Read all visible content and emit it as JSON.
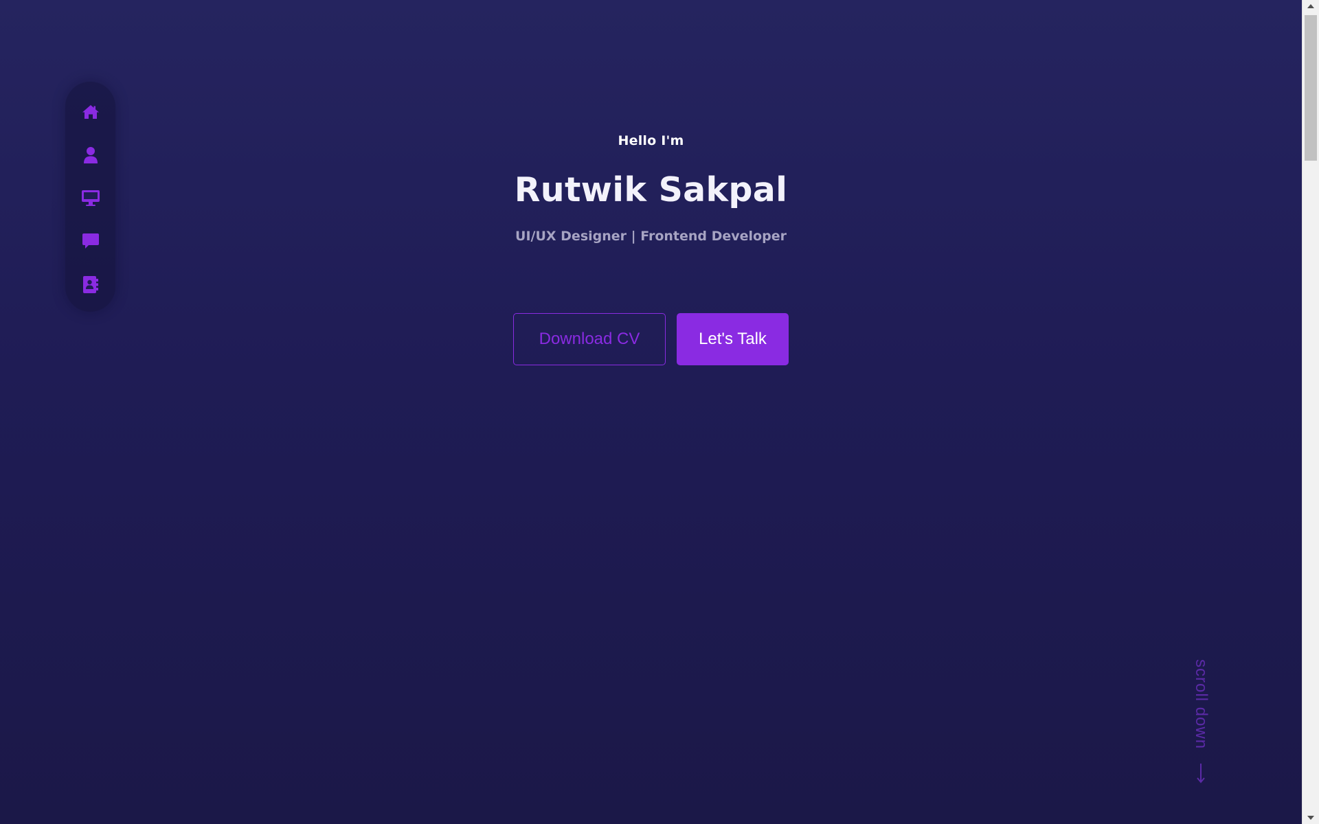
{
  "colors": {
    "accent": "#8a2be2",
    "background_top": "#25245f",
    "background_bottom": "#1b1848",
    "subtitle": "#a7a4c3"
  },
  "sidebar": {
    "items": [
      {
        "name": "home",
        "icon": "home-icon"
      },
      {
        "name": "about",
        "icon": "user-icon"
      },
      {
        "name": "projects",
        "icon": "desktop-icon"
      },
      {
        "name": "testimonials",
        "icon": "chat-icon"
      },
      {
        "name": "contact",
        "icon": "address-book-icon"
      }
    ]
  },
  "hero": {
    "greeting": "Hello I'm",
    "name": "Rutwik Sakpal",
    "role": "UI/UX Designer | Frontend Developer",
    "download_cv_label": "Download CV",
    "lets_talk_label": "Let's Talk"
  },
  "scroll": {
    "label": "scroll down",
    "icon": "arrow-down-icon"
  }
}
